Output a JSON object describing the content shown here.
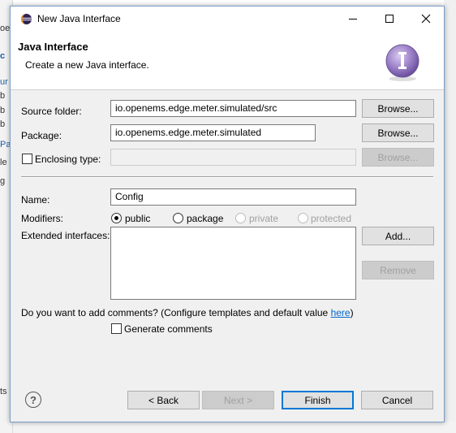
{
  "window": {
    "title": "New Java Interface"
  },
  "banner": {
    "title": "Java Interface",
    "description": "Create a new Java interface."
  },
  "form": {
    "source_folder": {
      "label": "Source folder:",
      "value": "io.openems.edge.meter.simulated/src",
      "browse": "Browse..."
    },
    "package": {
      "label": "Package:",
      "value": "io.openems.edge.meter.simulated",
      "browse": "Browse..."
    },
    "enclosing_type": {
      "label": "Enclosing type:",
      "value": "",
      "browse": "Browse..."
    },
    "name": {
      "label": "Name:",
      "value": "Config"
    },
    "modifiers": {
      "label": "Modifiers:",
      "options": [
        "public",
        "package",
        "private",
        "protected"
      ],
      "selected": "public"
    },
    "extended_interfaces": {
      "label": "Extended interfaces:",
      "add": "Add...",
      "remove": "Remove"
    },
    "comments": {
      "question": "Do you want to add comments? (Configure templates and default value ",
      "link": "here",
      "closing": ")",
      "generate_label": "Generate comments"
    }
  },
  "footer": {
    "back": "< Back",
    "next": "Next >",
    "finish": "Finish",
    "cancel": "Cancel"
  },
  "background": {
    "left_fragments": [
      "oe",
      "c",
      "ur",
      "b",
      "b",
      "b",
      "Pa",
      "le",
      "g",
      "ts"
    ]
  },
  "colors": {
    "dialog_bg": "#f0f0f0",
    "accent": "#0078d7",
    "icon_purple": "#8b6fb8",
    "link": "#0066cc"
  }
}
